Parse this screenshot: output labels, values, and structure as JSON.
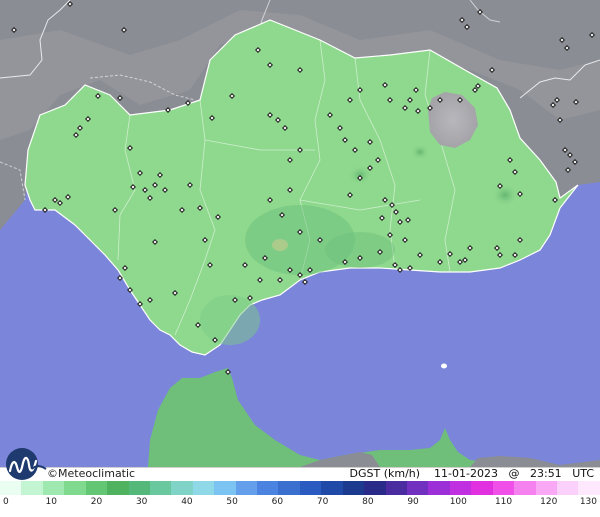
{
  "brand": {
    "copyright": "©",
    "name": "Meteoclimatic",
    "logo_icon": "meteoclimatic-wave-logo"
  },
  "map": {
    "variable": "DGST (km/h)",
    "date": "11-01-2023",
    "at": "@",
    "time": "23:51",
    "tz": "UTC",
    "colors": {
      "sea": "#7b85d9",
      "land_outside": "#8a8d93",
      "andalusia_fill": "#8fd98e",
      "hills": "#a8a8ad"
    }
  },
  "scale": {
    "labels": [
      "0",
      "10",
      "20",
      "30",
      "40",
      "50",
      "60",
      "70",
      "80",
      "90",
      "100",
      "110",
      "120",
      "130"
    ],
    "colors": [
      "#e9fdf0",
      "#c4f5d2",
      "#9fe8af",
      "#7fda8f",
      "#63c674",
      "#4eb25f",
      "#53b879",
      "#69c89d",
      "#7fd4c7",
      "#8fd8e8",
      "#7bc3f0",
      "#649fec",
      "#4a84e0",
      "#3a6fd0",
      "#2a5bc0",
      "#1f4aa8",
      "#1c3a8e",
      "#2a2a88",
      "#4a2ba0",
      "#7130c0",
      "#9c2fd8",
      "#c02fe0",
      "#e030e0",
      "#f050e8",
      "#f580f0",
      "#f8a8f5",
      "#fbd0fa",
      "#fde8fd"
    ]
  }
}
